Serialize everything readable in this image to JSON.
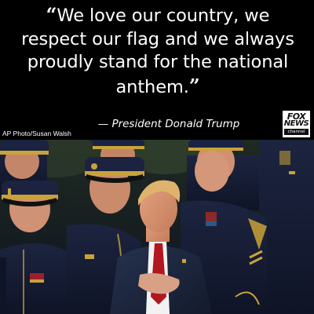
{
  "quote": {
    "open_mark": "“",
    "text": "We love our country, we respect our flag and we always proudly stand for the national anthem.",
    "close_mark": "”"
  },
  "attribution": {
    "dash": "—",
    "name": "President Donald Trump"
  },
  "photo_credit": "AP Photo/Susan Walsh",
  "logo": {
    "line1": "FOX",
    "line2": "NEWS",
    "line3": "channel"
  },
  "colors": {
    "background": "#000000",
    "text": "#ffffff",
    "uniform_navy": "#17203a",
    "braid_gold": "#c9a23a",
    "tie_red": "#b2161f"
  }
}
